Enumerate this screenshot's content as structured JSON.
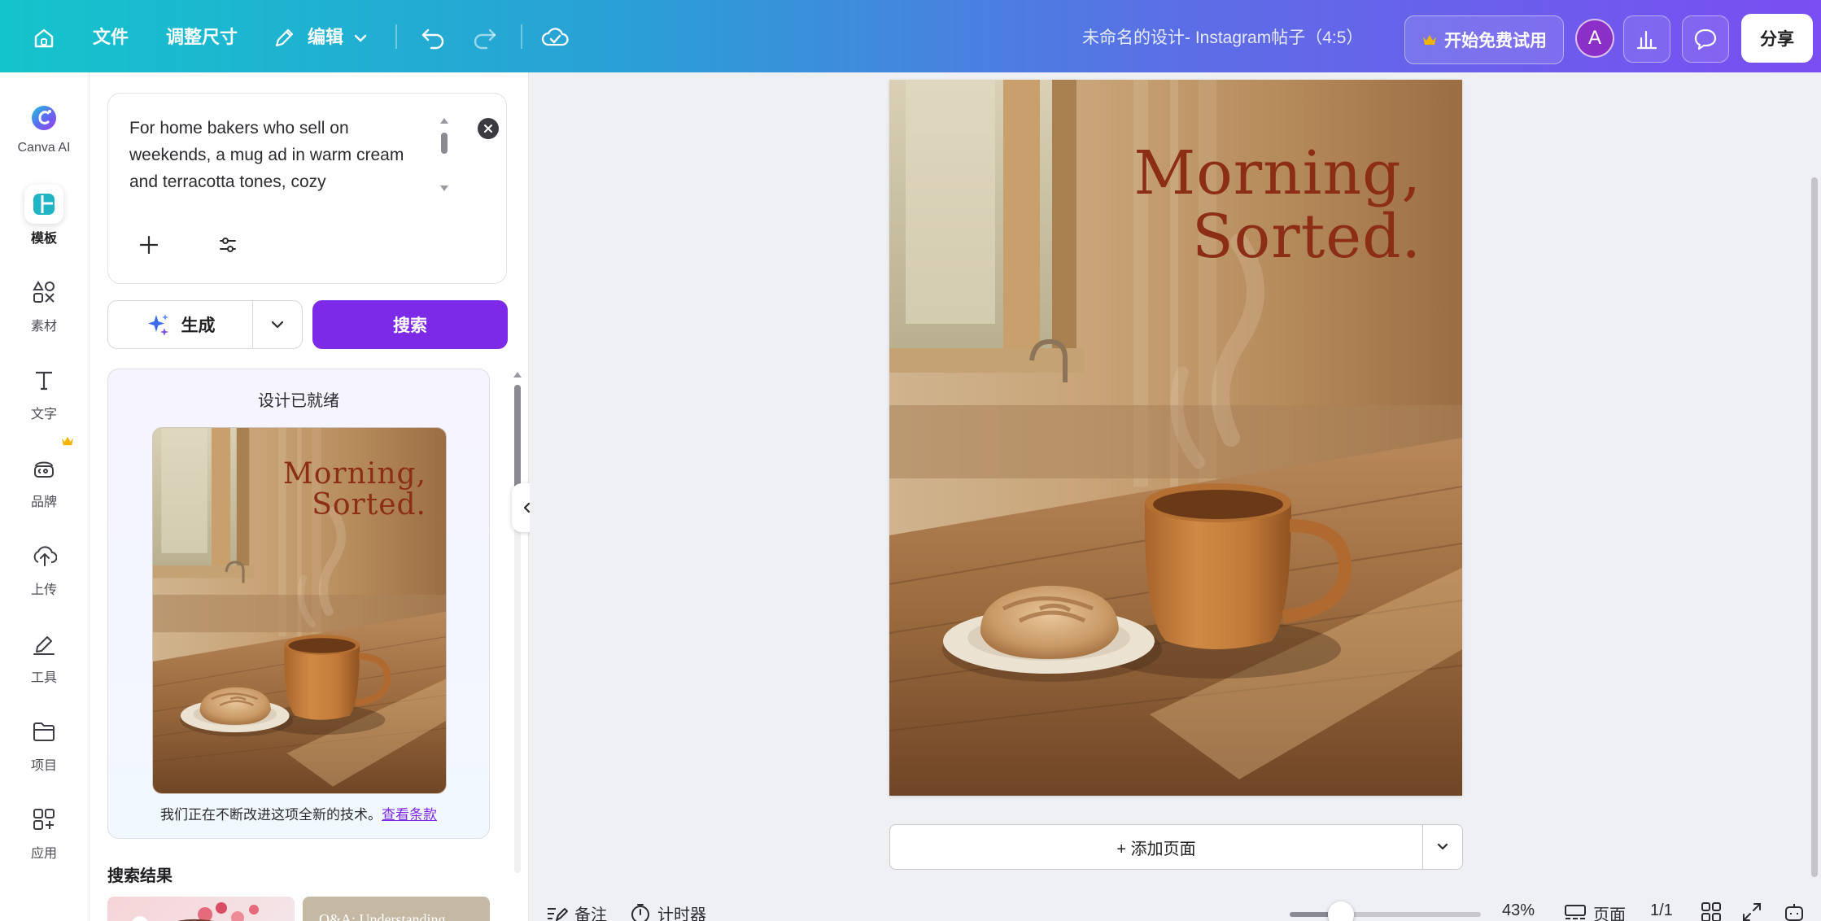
{
  "topbar": {
    "file": "文件",
    "resize": "调整尺寸",
    "edit": "编辑",
    "doc_title": "未命名的设计- Instagram帖子（4:5）",
    "trial": "开始免费试用",
    "avatar_letter": "A",
    "share": "分享"
  },
  "rail": {
    "items": [
      {
        "label": "Canva AI",
        "icon": "canva-ai-icon"
      },
      {
        "label": "模板",
        "icon": "templates-icon"
      },
      {
        "label": "素材",
        "icon": "elements-icon"
      },
      {
        "label": "文字",
        "icon": "text-icon"
      },
      {
        "label": "品牌",
        "icon": "brand-icon"
      },
      {
        "label": "上传",
        "icon": "upload-icon"
      },
      {
        "label": "工具",
        "icon": "tools-icon"
      },
      {
        "label": "项目",
        "icon": "projects-icon"
      },
      {
        "label": "应用",
        "icon": "apps-icon"
      }
    ]
  },
  "panel": {
    "prompt_text": "For home bakers who sell on weekends, a mug ad in warm cream and terracotta tones, cozy",
    "generate": "生成",
    "search": "搜索",
    "ready_title": "设计已就绪",
    "ready_note": "我们正在不断改进这项全新的技术。",
    "terms_link": "查看条款",
    "results_title": "搜索结果",
    "result_2_text": "Q&A: Understanding"
  },
  "design": {
    "headline_line1": "Morning,",
    "headline_line2": "Sorted."
  },
  "canvas": {
    "add_page": "+ 添加页面"
  },
  "bottombar": {
    "notes": "备注",
    "timer": "计时器",
    "zoom_level": "43%",
    "zoom_fraction": 0.43,
    "pages": "页面",
    "page_count": "1/1"
  },
  "colors": {
    "accent": "#7d2ae8",
    "headline": "#8c2e16",
    "avatar": "#8b2fc9"
  }
}
